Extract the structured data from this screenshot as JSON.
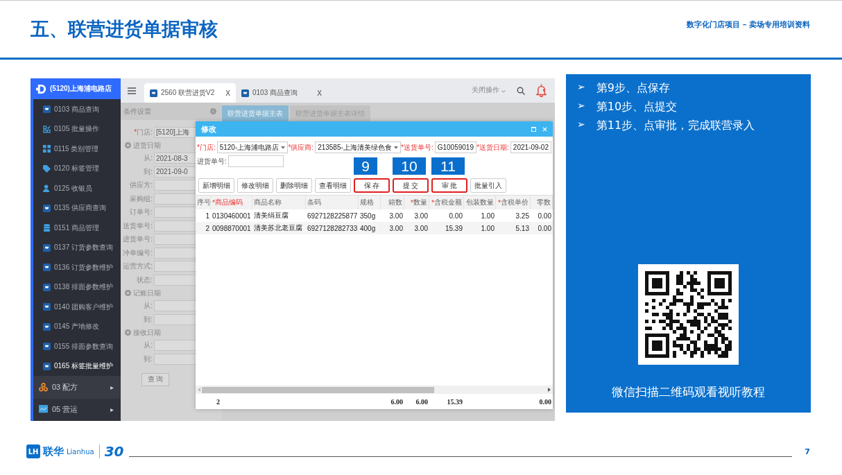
{
  "slide": {
    "title": "五、联营进货单据审核",
    "subtitle": "数字化门店项目 – 卖场专用培训资料",
    "page": "7"
  },
  "app": {
    "store": "(5120)上海浦电路店",
    "menu": [
      {
        "label": "0103 商品查询",
        "kind": "cart",
        "selected": false
      },
      {
        "label": "0105 批量操作",
        "kind": "grid",
        "selected": false
      },
      {
        "label": "0115 类别管理",
        "kind": "tiles",
        "selected": false
      },
      {
        "label": "0120 标签管理",
        "kind": "tag",
        "selected": false
      },
      {
        "label": "0125 收银员",
        "kind": "person",
        "selected": false
      },
      {
        "label": "0135 供应商查询",
        "kind": "cart",
        "selected": false
      },
      {
        "label": "0151 商品管理",
        "kind": "database",
        "selected": false
      },
      {
        "label": "0137 订货参数查询",
        "kind": "cart",
        "selected": false
      },
      {
        "label": "0136 订货参数维护",
        "kind": "cart",
        "selected": false
      },
      {
        "label": "0138 排面参数维护",
        "kind": "cart",
        "selected": false
      },
      {
        "label": "0140 团购客户维护",
        "kind": "cart",
        "selected": false
      },
      {
        "label": "0145 产地修改",
        "kind": "cart",
        "selected": false
      },
      {
        "label": "0155 排面参数查询",
        "kind": "cart",
        "selected": false
      },
      {
        "label": "0165 标签批量维护",
        "kind": "cart",
        "selected": true
      }
    ],
    "groups": [
      {
        "label": "03 配方",
        "kind": "nodes",
        "arrow": "▸"
      },
      {
        "label": "05 营运",
        "kind": "chart",
        "arrow": "▸"
      }
    ],
    "tabs": [
      {
        "label": "2560 联营进货V2",
        "close": "X",
        "selected": true
      },
      {
        "label": "0103 商品查询",
        "close": "X",
        "selected": false
      }
    ],
    "actions_menu": "关闭操作",
    "filter": {
      "title": "条件设置",
      "items": [
        {
          "kind": "field",
          "mark": "*",
          "label": "门店:",
          "value": "[5120]上海"
        },
        {
          "kind": "section",
          "label": "进货日期"
        },
        {
          "kind": "field",
          "label": "从:",
          "value": "2021-08-3"
        },
        {
          "kind": "field",
          "label": "到:",
          "value": "2021-09-0"
        },
        {
          "kind": "field",
          "label": "供应方:"
        },
        {
          "kind": "field",
          "label": "采购组:"
        },
        {
          "kind": "field",
          "label": "订单号:"
        },
        {
          "kind": "field",
          "label": "送货单号:"
        },
        {
          "kind": "field",
          "label": "进货单号:"
        },
        {
          "kind": "field",
          "label": "冲单编号:"
        },
        {
          "kind": "field",
          "label": "运营方式:"
        },
        {
          "kind": "field",
          "label": "状态:"
        },
        {
          "kind": "section",
          "label": "记账日期"
        },
        {
          "kind": "field",
          "label": "从:"
        },
        {
          "kind": "field",
          "label": "到:"
        },
        {
          "kind": "section",
          "label": "接收日期"
        },
        {
          "kind": "field",
          "label": "从:"
        },
        {
          "kind": "field",
          "label": "到:"
        }
      ],
      "query_button": "查 询"
    },
    "subtabs": [
      {
        "label": "联营进货单据主表",
        "selected": true
      },
      {
        "label": "联营进货单据主表详情",
        "selected": false
      }
    ],
    "dialog": {
      "title": "修改",
      "fields": [
        {
          "kind": "select",
          "mark": "*",
          "label": "门店:",
          "value": "5120-上海浦电路店"
        },
        {
          "kind": "select",
          "mark": "*",
          "label": "供应商:",
          "value": "213585-上海清美绿色食"
        },
        {
          "kind": "input",
          "mark": "*",
          "label": "送货单号:",
          "value": "G10059019"
        },
        {
          "kind": "input",
          "mark": "*",
          "label": "送货日期:",
          "value": "2021-09-02"
        },
        {
          "kind": "input",
          "label": "进货单号:"
        }
      ],
      "buttons": [
        {
          "label": "新增明细",
          "highlighted": false
        },
        {
          "label": "修改明细",
          "highlighted": false
        },
        {
          "label": "删除明细",
          "highlighted": false
        },
        {
          "label": "查看明细",
          "highlighted": false
        },
        {
          "label": "保 存",
          "highlighted": true,
          "step": "9"
        },
        {
          "label": "提 交",
          "highlighted": true,
          "step": "10"
        },
        {
          "label": "审 批",
          "highlighted": true,
          "step": "11"
        },
        {
          "label": "批量引入",
          "highlighted": false
        }
      ],
      "columns": [
        {
          "label": "序号",
          "emphasis": false,
          "kind": "index"
        },
        {
          "label": "商品编码",
          "mark": "*",
          "emphasis": true,
          "kind": "text",
          "total": "2"
        },
        {
          "label": "商品名称",
          "emphasis": false,
          "kind": "text"
        },
        {
          "label": "条码",
          "emphasis": false,
          "kind": "text"
        },
        {
          "label": "规格",
          "emphasis": false,
          "kind": "text"
        },
        {
          "label": "箱数",
          "emphasis": false,
          "kind": "number",
          "total": "6.00"
        },
        {
          "label": "数量",
          "mark": "*",
          "emphasis": false,
          "kind": "number",
          "total": "6.00"
        },
        {
          "label": "含税金额",
          "mark": "*",
          "emphasis": false,
          "kind": "number",
          "total": "15.39"
        },
        {
          "label": "包装数量",
          "emphasis": false,
          "kind": "number"
        },
        {
          "label": "含税单价",
          "mark": "*",
          "emphasis": false,
          "kind": "number"
        },
        {
          "label": "零数",
          "emphasis": false,
          "kind": "number",
          "total": "0.00"
        }
      ],
      "rows": [
        [
          "1",
          "0130460001",
          "清美绢豆腐",
          "6927128225877",
          "350g",
          "3.00",
          "3.00",
          "0.00",
          "1.00",
          "3.25",
          "0.00"
        ],
        [
          "2",
          "0098870001",
          "清美苏北老豆腐",
          "6927128282733",
          "400g",
          "3.00",
          "3.00",
          "15.39",
          "1.00",
          "5.13",
          "0.00"
        ]
      ]
    }
  },
  "steps": [
    {
      "text": "第9步、点保存"
    },
    {
      "text": "第10步、点提交"
    },
    {
      "text": "第11步、点审批，完成联营录入"
    }
  ],
  "bullet": "➢",
  "qr_caption": "微信扫描二维码观看视听教程",
  "logo": {
    "name": "联华",
    "latin": "Lianhua",
    "mark": "LH",
    "anniversary": "30"
  }
}
